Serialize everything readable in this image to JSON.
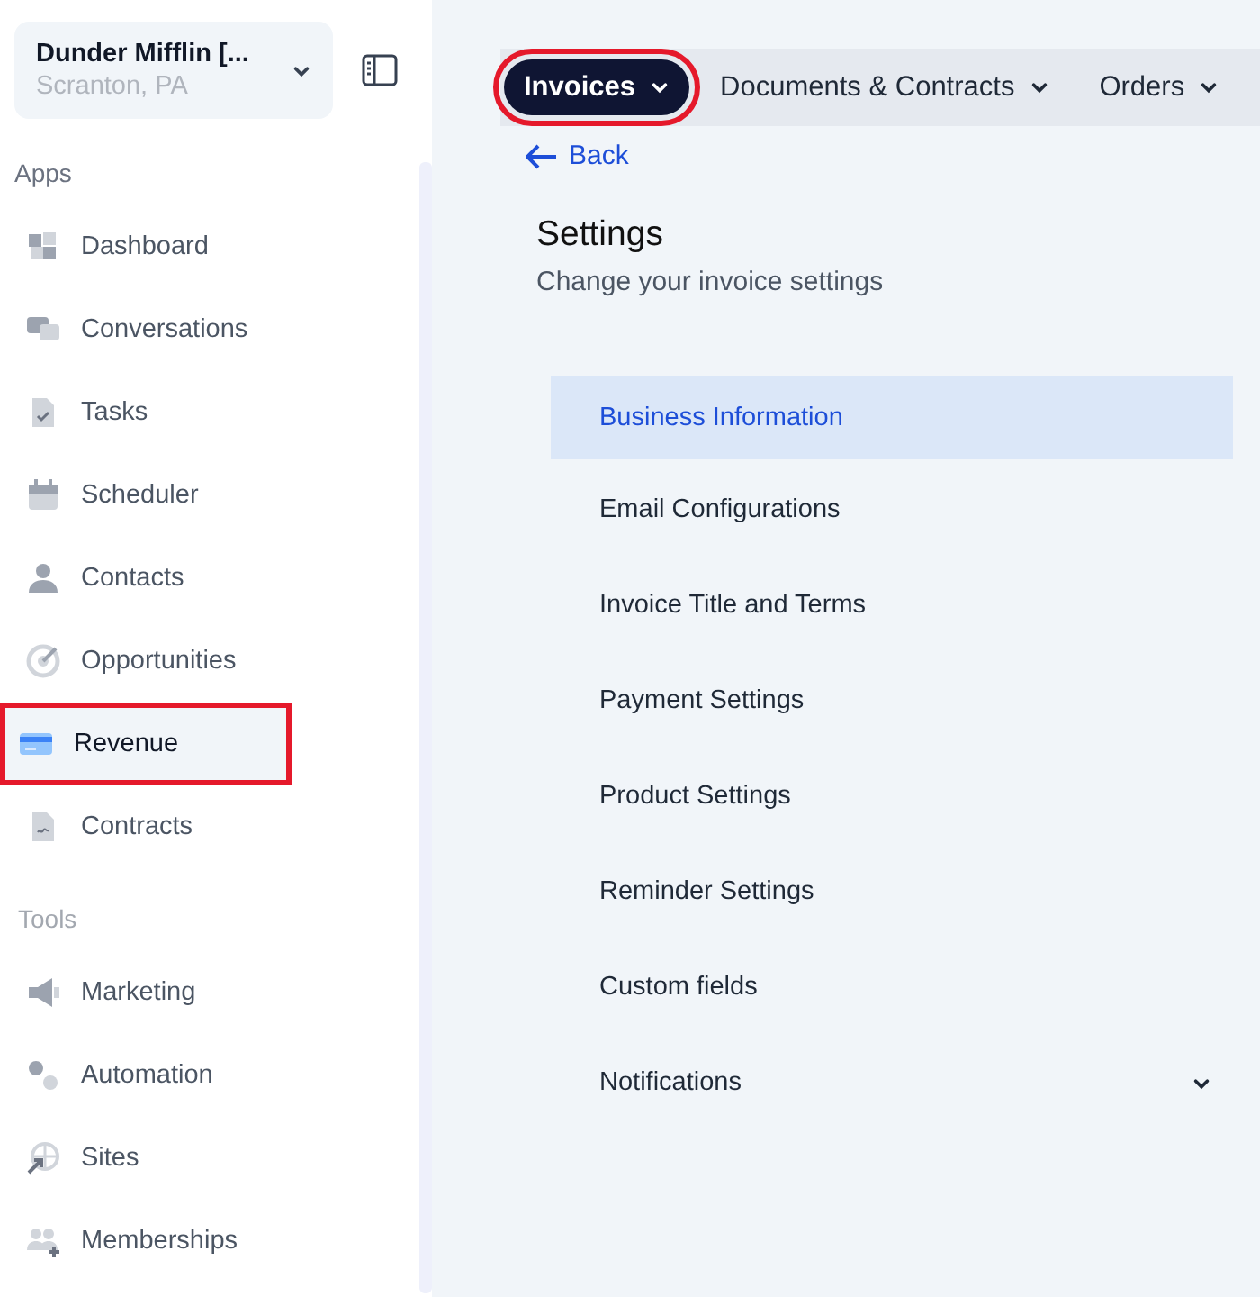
{
  "account": {
    "name": "Dunder Mifflin [...",
    "location": "Scranton, PA"
  },
  "sidebar": {
    "sections": [
      {
        "title": "Apps",
        "items": [
          {
            "label": "Dashboard",
            "selected": false,
            "highlighted": false
          },
          {
            "label": "Conversations",
            "selected": false,
            "highlighted": false
          },
          {
            "label": "Tasks",
            "selected": false,
            "highlighted": false
          },
          {
            "label": "Scheduler",
            "selected": false,
            "highlighted": false
          },
          {
            "label": "Contacts",
            "selected": false,
            "highlighted": false
          },
          {
            "label": "Opportunities",
            "selected": false,
            "highlighted": false
          },
          {
            "label": "Revenue",
            "selected": true,
            "highlighted": true
          },
          {
            "label": "Contracts",
            "selected": false,
            "highlighted": false
          }
        ]
      },
      {
        "title": "Tools",
        "items": [
          {
            "label": "Marketing",
            "selected": false,
            "highlighted": false
          },
          {
            "label": "Automation",
            "selected": false,
            "highlighted": false
          },
          {
            "label": "Sites",
            "selected": false,
            "highlighted": false
          },
          {
            "label": "Memberships",
            "selected": false,
            "highlighted": false
          }
        ]
      }
    ]
  },
  "tabs": [
    {
      "label": "Invoices",
      "selected": true,
      "highlighted": true
    },
    {
      "label": "Documents & Contracts",
      "selected": false,
      "highlighted": false
    },
    {
      "label": "Orders",
      "selected": false,
      "highlighted": false
    }
  ],
  "back_link": "Back",
  "settings": {
    "title": "Settings",
    "subtitle": "Change your invoice settings",
    "items": [
      {
        "label": "Business Information",
        "selected": true,
        "expandable": false
      },
      {
        "label": "Email Configurations",
        "selected": false,
        "expandable": false
      },
      {
        "label": "Invoice Title and Terms",
        "selected": false,
        "expandable": false
      },
      {
        "label": "Payment Settings",
        "selected": false,
        "expandable": false
      },
      {
        "label": "Product Settings",
        "selected": false,
        "expandable": false
      },
      {
        "label": "Reminder Settings",
        "selected": false,
        "expandable": false
      },
      {
        "label": "Custom fields",
        "selected": false,
        "expandable": false
      },
      {
        "label": "Notifications",
        "selected": false,
        "expandable": true
      }
    ]
  }
}
